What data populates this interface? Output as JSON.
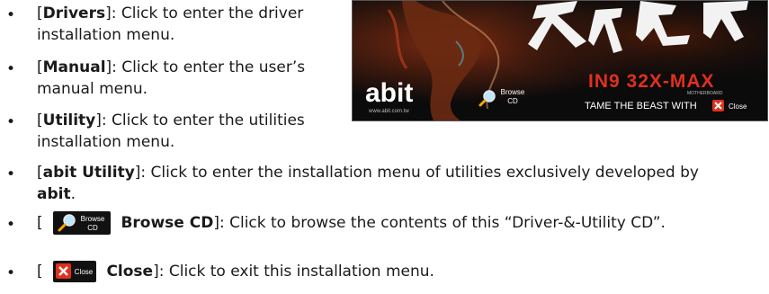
{
  "items": [
    {
      "bullet": "•",
      "open": "[",
      "name": "Drivers",
      "rest": "]: Click to enter the driver",
      "line2": "installation menu."
    },
    {
      "bullet": "•",
      "open": "[",
      "name": "Manual",
      "rest": "]: Click to enter the user’s",
      "line2": "manual menu."
    },
    {
      "bullet": "•",
      "open": "[",
      "name": "Utility",
      "rest": "]: Click to enter the utilities",
      "line2": "installation menu."
    },
    {
      "bullet": "•",
      "open": "[",
      "name": "abit Utility",
      "rest": "]: Click to enter the installation menu of utilities exclusively developed by",
      "line2_bold": "abit",
      "line2_end": "."
    },
    {
      "bullet": "•",
      "open": "[",
      "icon_label_top": "Browse",
      "icon_label_bottom": "CD",
      "name": "Browse CD",
      "rest": "]: Click to browse the contents of this “Driver-&-Utility CD”."
    },
    {
      "bullet": "•",
      "open": "[",
      "icon_label": "Close",
      "name": "Close",
      "rest": "]: Click to exit this installation menu."
    }
  ],
  "cd_menu": {
    "brand": "abit",
    "url": "www.abit.com.tw",
    "browse_top": "Browse",
    "browse_bottom": "CD",
    "model": "IN9 32X-MAX",
    "subtitle": "MOTHERBOARD",
    "tagline": "TAME THE BEAST WITH",
    "close": "Close",
    "colors": {
      "background": "#0b0b0b",
      "accent_red": "#e0301e",
      "text": "#ffffff"
    }
  }
}
